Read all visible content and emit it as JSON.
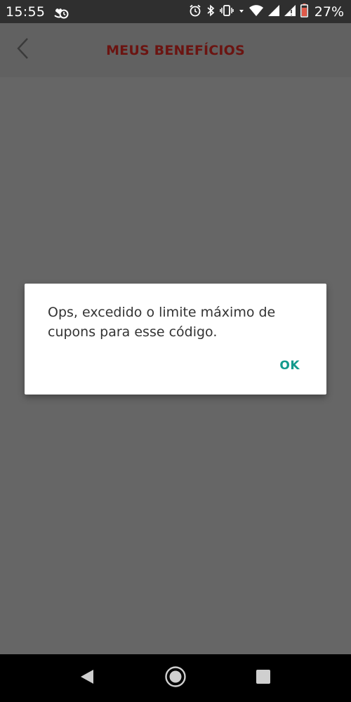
{
  "status_bar": {
    "time": "15:55",
    "battery_percent": "27%"
  },
  "app_bar": {
    "title": "MEUS BENEFÍCIOS"
  },
  "dialog": {
    "message": "Ops, excedido o limite máximo de cupons para esse código.",
    "ok_label": "OK"
  },
  "colors": {
    "title": "#6b1411",
    "accent": "#139a8c",
    "overlay": "#666666"
  }
}
